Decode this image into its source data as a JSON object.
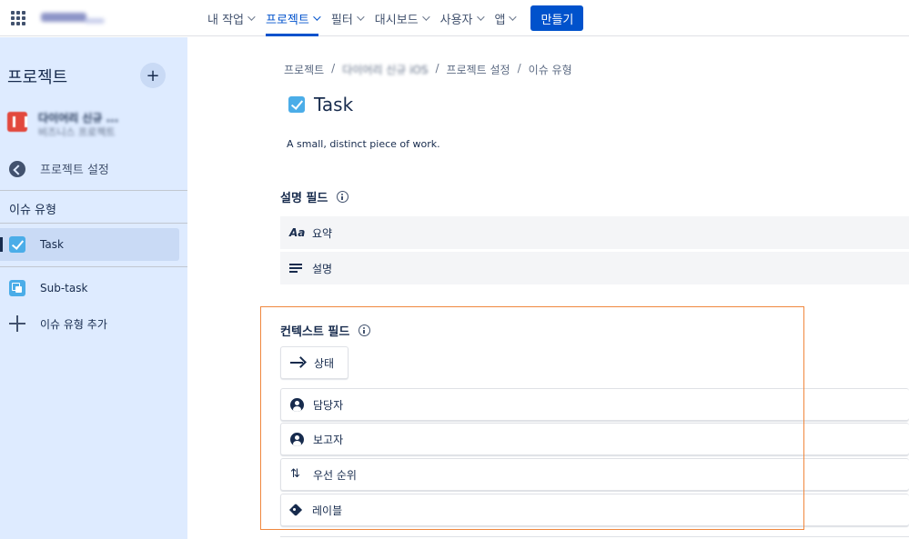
{
  "topnav": {
    "items": [
      {
        "label": "내 작업"
      },
      {
        "label": "프로젝트"
      },
      {
        "label": "필터"
      },
      {
        "label": "대시보드"
      },
      {
        "label": "사용자"
      },
      {
        "label": "앱"
      }
    ],
    "create_label": "만들기",
    "active_item": "프로젝트",
    "accent": "#0052cc"
  },
  "sidebar": {
    "title": "프로젝트",
    "project_name": "다이어리 신규 ...",
    "project_type": "비즈니스 프로젝트",
    "back_label": "프로젝트 설정",
    "section_label": "이슈 유형",
    "items": [
      {
        "label": "Task",
        "icon": "task-icon",
        "selected": true
      },
      {
        "label": "Sub-task",
        "icon": "subtask-icon",
        "selected": false
      },
      {
        "label": "이슈 유형 추가",
        "icon": "plus-icon",
        "selected": false
      }
    ],
    "background": "#deebff"
  },
  "main": {
    "breadcrumb": [
      "프로젝트",
      "다이어리 신규 iOS",
      "프로젝트 설정",
      "이슈 유형"
    ],
    "title": "Task",
    "description": "A small, distinct piece of work.",
    "description_fields": {
      "heading": "설명 필드",
      "rows": [
        {
          "icon": "text-aa-icon",
          "label": "요약"
        },
        {
          "icon": "lines-icon",
          "label": "설명"
        }
      ]
    },
    "context_fields": {
      "heading": "컨텍스트 필드",
      "status_label": "상태",
      "rows": [
        {
          "icon": "user-icon",
          "label": "담당자"
        },
        {
          "icon": "user-icon",
          "label": "보고자"
        },
        {
          "icon": "sort-icon",
          "label": "우선 순위"
        },
        {
          "icon": "tag-icon",
          "label": "레이블"
        }
      ]
    },
    "highlight_color": "#f0883e"
  }
}
